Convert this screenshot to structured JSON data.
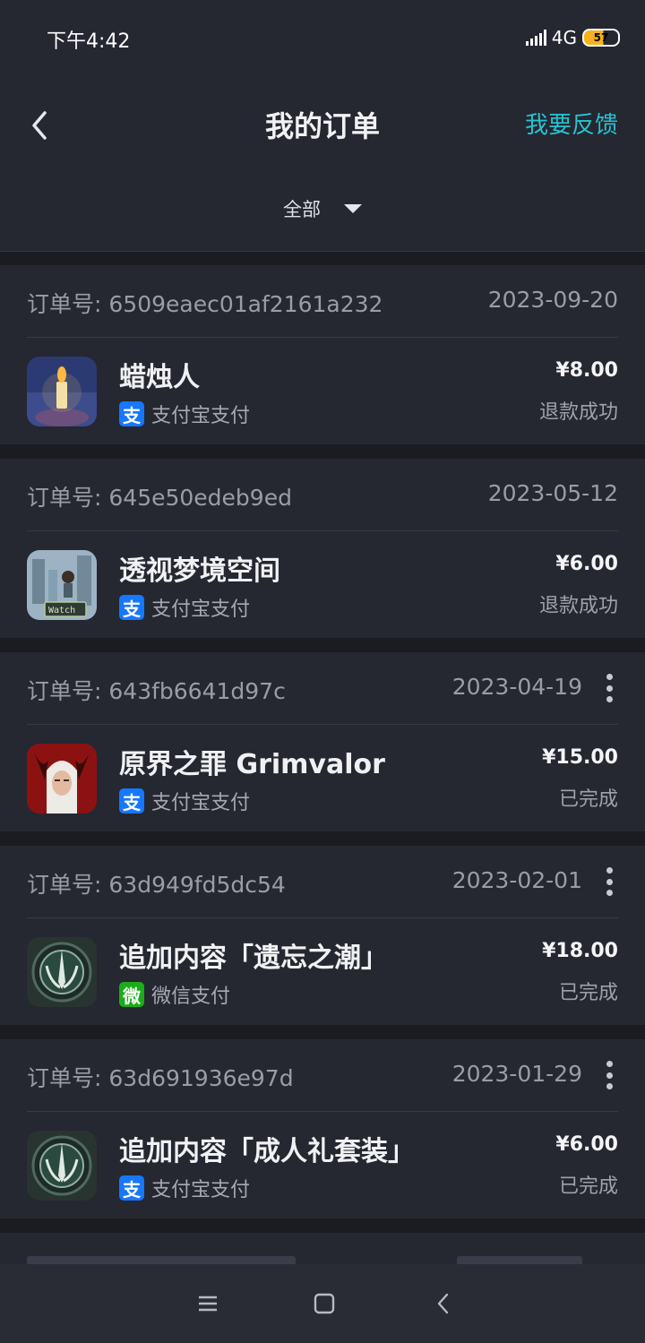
{
  "status_bar": {
    "time": "下午4:42",
    "network": "4G",
    "battery": "57"
  },
  "header": {
    "title": "我的订单",
    "feedback": "我要反馈",
    "filter": "全部"
  },
  "order_prefix": "订单号:",
  "orders": [
    {
      "order_no": "6509eaec01af2161a232",
      "date": "2023-09-20",
      "name": "蜡烛人",
      "pay_method": "支付宝支付",
      "pay_type": "alipay",
      "price": "¥8.00",
      "status": "退款成功",
      "has_menu": false
    },
    {
      "order_no": "645e50edeb9ed",
      "date": "2023-05-12",
      "name": "透视梦境空间",
      "pay_method": "支付宝支付",
      "pay_type": "alipay",
      "price": "¥6.00",
      "status": "退款成功",
      "has_menu": false
    },
    {
      "order_no": "643fb6641d97c",
      "date": "2023-04-19",
      "name": "原界之罪 Grimvalor",
      "pay_method": "支付宝支付",
      "pay_type": "alipay",
      "price": "¥15.00",
      "status": "已完成",
      "has_menu": true
    },
    {
      "order_no": "63d949fd5dc54",
      "date": "2023-02-01",
      "name": "追加内容「遗忘之潮」",
      "pay_method": "微信支付",
      "pay_type": "wechat",
      "price": "¥18.00",
      "status": "已完成",
      "has_menu": true
    },
    {
      "order_no": "63d691936e97d",
      "date": "2023-01-29",
      "name": "追加内容「成人礼套装」",
      "pay_method": "支付宝支付",
      "pay_type": "alipay",
      "price": "¥6.00",
      "status": "已完成",
      "has_menu": true
    }
  ],
  "pay_icons": {
    "alipay": "支",
    "wechat": "微"
  },
  "colors": {
    "accent": "#27c2cf",
    "background": "#1b1c22",
    "card": "#252731",
    "alipay": "#1677ff",
    "wechat": "#1aad19"
  }
}
